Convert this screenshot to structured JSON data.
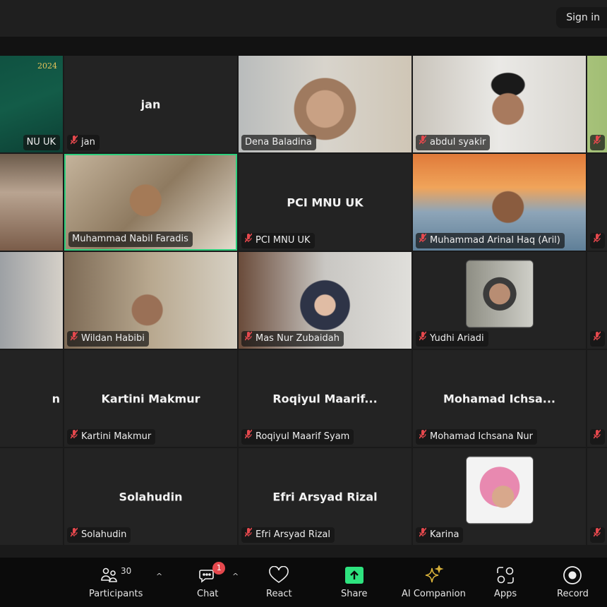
{
  "header": {
    "sign_in": "Sign in"
  },
  "colors": {
    "active_speaker": "#2ecf7d",
    "muted": "#e5484d",
    "share": "#2ee37f",
    "ai": "#d9b23a"
  },
  "rows": [
    [
      {
        "label": "NU UK",
        "type": "video",
        "muted": false,
        "overlay": "2024",
        "bg": "linear-gradient(160deg,#0d4a3c,#135c48 60%,#0c3f34)"
      },
      {
        "label": "jan",
        "type": "name",
        "big": "jan",
        "muted": true
      },
      {
        "label": "Dena Baladina",
        "type": "video",
        "muted": false,
        "bg": "radial-gradient(circle at 50% 55%,#c9a184 0 18%,#9f7a5f 19% 30%,transparent 31%),linear-gradient(90deg,#b9bcbc,#d8d4cc 50%,#cfc6b6)"
      },
      {
        "label": "abdul syakir",
        "type": "video",
        "muted": true,
        "bg": "radial-gradient(circle at 55% 55%,#a87a5e 0 14%,transparent 15%),radial-gradient(ellipse at 55% 30%,#1a1a1a 0 12%,transparent 13%),linear-gradient(90deg,#c9c4bb,#eae9e6 50%,#d9d6d0)"
      },
      {
        "label": "",
        "type": "video",
        "muted": true,
        "bg": "linear-gradient(90deg,#a7c27a,#6f9a49)"
      }
    ],
    [
      {
        "label": "",
        "type": "video",
        "muted": false,
        "bg": "linear-gradient(180deg,#6b5a4a,#b9a491 40%,#7a5c49)"
      },
      {
        "label": "Muhammad Nabil Faradis",
        "type": "video",
        "muted": false,
        "active": true,
        "bg": "radial-gradient(circle at 47% 48%,#a47a57 0 15%,transparent 16%),linear-gradient(135deg,#c4b39b,#8e7a60 50%,#e3dbcd)"
      },
      {
        "label": "PCI MNU UK",
        "type": "name",
        "big": "PCI MNU UK",
        "muted": true
      },
      {
        "label": "Muhammad Arinal Haq (Aril)",
        "type": "video",
        "muted": true,
        "bg": "radial-gradient(circle at 55% 55%,#8a5c3f 0 14%,transparent 15%),linear-gradient(180deg,#e07a3a,#f0a45a 35%,#8ea5b8 60%,#5f7f98)"
      },
      {
        "label": "",
        "type": "video",
        "muted": true,
        "bg": "#232323"
      }
    ],
    [
      {
        "label": "",
        "type": "video",
        "muted": false,
        "bg": "linear-gradient(90deg,#3a4d66,#d5d0c8)"
      },
      {
        "label": "Wildan Habibi",
        "type": "video",
        "muted": true,
        "bg": "radial-gradient(circle at 48% 60%,#9a7056 0 14%,transparent 15%),linear-gradient(90deg,#7d6a55,#b8a88f 50%,#d7d1c4)"
      },
      {
        "label": "Mas Nur Zubaidah",
        "type": "video",
        "muted": true,
        "bg": "radial-gradient(circle at 50% 55%,#e0bca4 0 10%,#2e3447 11% 24%,transparent 25%),linear-gradient(90deg,#6a4b3a,#c9c7c3 50%,#e0dfdb)"
      },
      {
        "label": "Yudhi Ariadi",
        "type": "avatar",
        "muted": true,
        "bg": "radial-gradient(circle at 50% 50%,#b88d73 0 22%,#3b3b3b 23% 35%,transparent 36%),linear-gradient(90deg,#8e8e84,#cfcfc8)"
      },
      {
        "label": "",
        "type": "video",
        "muted": true,
        "bg": "#232323"
      }
    ],
    [
      {
        "label": "",
        "type": "name",
        "big": "n",
        "muted": false
      },
      {
        "label": "Kartini Makmur",
        "type": "name",
        "big": "Kartini Makmur",
        "muted": true
      },
      {
        "label": "Roqiyul Maarif Syam",
        "type": "name",
        "big": "Roqiyul  Maarif...",
        "muted": true
      },
      {
        "label": "Mohamad Ichsana Nur",
        "type": "name",
        "big": "Mohamad  Ichsa...",
        "muted": true
      },
      {
        "label": "",
        "type": "video",
        "muted": true,
        "bg": "#232323"
      }
    ],
    [
      {
        "label": "",
        "type": "name",
        "big": "",
        "muted": false
      },
      {
        "label": "Solahudin",
        "type": "name",
        "big": "Solahudin",
        "muted": true
      },
      {
        "label": "Efri Arsyad Rizal",
        "type": "name",
        "big": "Efri Arsyad Rizal",
        "muted": true
      },
      {
        "label": "Karina",
        "type": "avatar",
        "muted": true,
        "bg": "radial-gradient(circle at 55% 60%,#d8a88c 0 20%,transparent 21%),radial-gradient(circle at 50% 45%,#e889b0 0 40%,transparent 41%),linear-gradient(#f3f3f3,#f3f3f3)"
      },
      {
        "label": "",
        "type": "video",
        "muted": true,
        "bg": "#232323"
      }
    ]
  ],
  "toolbar": {
    "participants": {
      "label": "Participants",
      "count": "30",
      "icon": "participants-icon"
    },
    "chat": {
      "label": "Chat",
      "badge": "1",
      "icon": "chat-icon"
    },
    "react": {
      "label": "React",
      "icon": "heart-icon"
    },
    "share": {
      "label": "Share",
      "icon": "share-arrow-icon"
    },
    "ai": {
      "label": "AI Companion",
      "icon": "sparkle-icon"
    },
    "apps": {
      "label": "Apps",
      "icon": "apps-icon"
    },
    "record": {
      "label": "Record",
      "icon": "record-icon"
    }
  }
}
